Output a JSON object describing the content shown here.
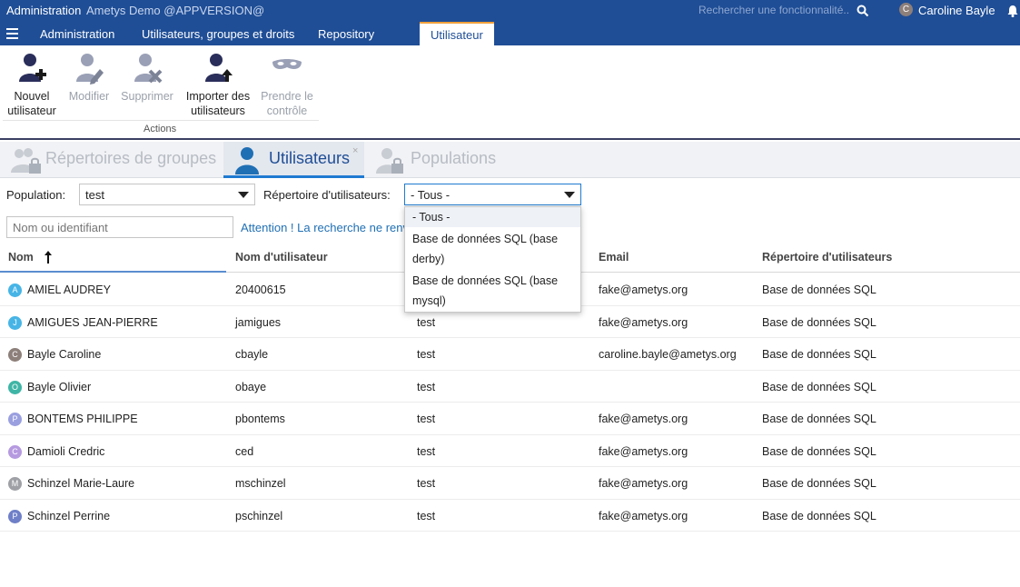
{
  "header": {
    "title": "Administration",
    "subtitle": "Ametys Demo @APPVERSION@",
    "search_placeholder": "Rechercher une fonctionnalité...",
    "user_initial": "C",
    "user_name": "Caroline Bayle"
  },
  "nav": {
    "tabs": [
      "Administration",
      "Utilisateurs, groupes et droits",
      "Repository"
    ],
    "active_tab": "Utilisateur"
  },
  "ribbon": {
    "buttons": [
      {
        "label": "Nouvel utilisateur",
        "icon": "user-add-icon"
      },
      {
        "label": "Modifier",
        "icon": "user-edit-icon"
      },
      {
        "label": "Supprimer",
        "icon": "user-delete-icon"
      },
      {
        "label": "Importer des utilisateurs",
        "icon": "user-import-icon"
      },
      {
        "label": "Prendre le contrôle",
        "icon": "mask-icon"
      }
    ],
    "group": "Actions"
  },
  "tooltabs": {
    "groups": "Répertoires de groupes",
    "users": "Utilisateurs",
    "close": "×",
    "populations": "Populations"
  },
  "filters": {
    "population_label": "Population:",
    "population_value": "test",
    "directory_label": "Répertoire d'utilisateurs:",
    "directory_value": "- Tous -",
    "search_placeholder": "Nom ou identifiant",
    "warning": "Attention ! La recherche ne renvoie"
  },
  "dropdown": {
    "options": [
      "- Tous -",
      "Base de données SQL (base derby)",
      "Base de données SQL (base mysql)"
    ],
    "selected": 0
  },
  "grid": {
    "headers": {
      "name": "Nom",
      "login": "Nom d'utilisateur",
      "email": "Email",
      "directory": "Répertoire d'utilisateurs"
    },
    "rows": [
      {
        "initial": "A",
        "color": "#47b4e6",
        "name": "AMIEL AUDREY",
        "login": "20400615",
        "population": "",
        "email": "fake@ametys.org",
        "directory": "Base de données SQL"
      },
      {
        "initial": "J",
        "color": "#47b4e6",
        "name": "AMIGUES JEAN-PIERRE",
        "login": "jamigues",
        "population": "test",
        "email": "fake@ametys.org",
        "directory": "Base de données SQL"
      },
      {
        "initial": "C",
        "color": "#8d7f7a",
        "name": "Bayle Caroline",
        "login": "cbayle",
        "population": "test",
        "email": "caroline.bayle@ametys.org",
        "directory": "Base de données SQL"
      },
      {
        "initial": "O",
        "color": "#3fb5a6",
        "name": "Bayle Olivier",
        "login": "obaye",
        "population": "test",
        "email": "",
        "directory": "Base de données SQL"
      },
      {
        "initial": "P",
        "color": "#9a9fe0",
        "name": "BONTEMS PHILIPPE",
        "login": "pbontems",
        "population": "test",
        "email": "fake@ametys.org",
        "directory": "Base de données SQL"
      },
      {
        "initial": "C",
        "color": "#b69ae0",
        "name": "Damioli Credric",
        "login": "ced",
        "population": "test",
        "email": "fake@ametys.org",
        "directory": "Base de données SQL"
      },
      {
        "initial": "M",
        "color": "#9ea0a5",
        "name": "Schinzel Marie-Laure",
        "login": "mschinzel",
        "population": "test",
        "email": "fake@ametys.org",
        "directory": "Base de données SQL"
      },
      {
        "initial": "P",
        "color": "#6f7fc8",
        "name": "Schinzel Perrine",
        "login": "pschinzel",
        "population": "test",
        "email": "fake@ametys.org",
        "directory": "Base de données SQL"
      }
    ]
  }
}
